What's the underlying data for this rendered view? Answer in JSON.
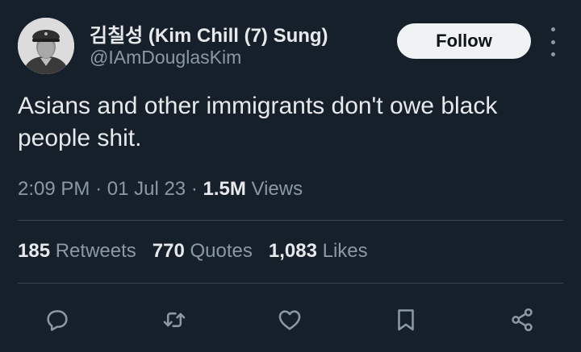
{
  "author": {
    "display_name": "김칠성 (Kim Chill (7) Sung)",
    "handle": "@IAmDouglasKim",
    "avatar": "portrait-photo"
  },
  "follow_label": "Follow",
  "tweet": {
    "text": "Asians and other immigrants don't owe black people shit."
  },
  "meta": {
    "time": "2:09 PM",
    "separator": "·",
    "date": "01 Jul 23",
    "views_count": "1.5M",
    "views_label": "Views"
  },
  "stats": {
    "retweets_count": "185",
    "retweets_label": "Retweets",
    "quotes_count": "770",
    "quotes_label": "Quotes",
    "likes_count": "1,083",
    "likes_label": "Likes"
  },
  "actions": [
    "reply-icon",
    "retweet-icon",
    "like-icon",
    "bookmark-icon",
    "share-icon"
  ],
  "colors": {
    "background": "#15202b",
    "primary_text": "#e7e9ea",
    "secondary_text": "#8b98a5",
    "divider": "#38444d",
    "follow_button_bg": "#eff3f4"
  }
}
